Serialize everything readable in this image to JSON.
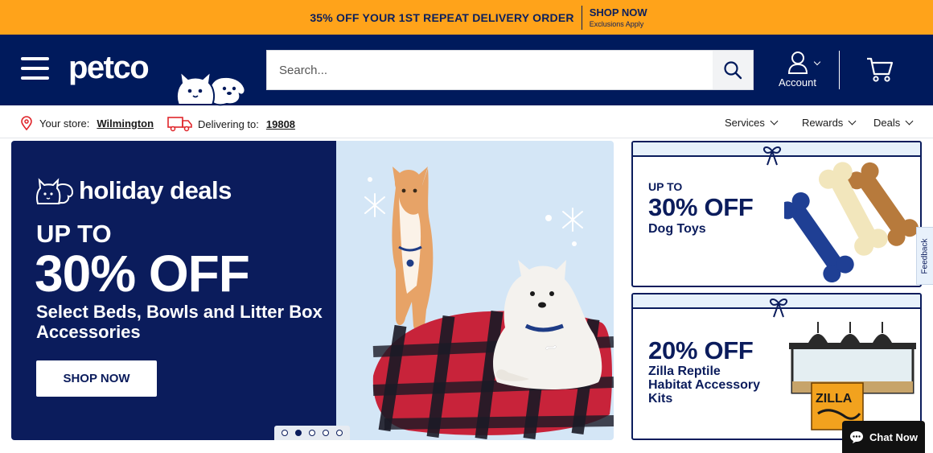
{
  "promo": {
    "main_text": "35% OFF YOUR 1ST REPEAT DELIVERY ORDER",
    "cta": "SHOP NOW",
    "cta_sub": "Exclusions Apply"
  },
  "header": {
    "logo": "petco",
    "search_placeholder": "Search...",
    "account_label": "Account"
  },
  "subnav": {
    "store_label": "Your store:",
    "store_name": "Wilmington",
    "deliver_label": "Delivering to:",
    "zip": "19808",
    "links": [
      "Services",
      "Rewards",
      "Deals"
    ]
  },
  "hero": {
    "brand": "holiday deals",
    "upto": "UP TO",
    "percent": "30% OFF",
    "subtitle": "Select Beds, Bowls and Litter Box Accessories",
    "cta": "SHOP NOW",
    "slides_count": 5,
    "active_slide": 2
  },
  "cards": [
    {
      "line1": "UP TO",
      "line2": "30% OFF",
      "line3": "Dog Toys"
    },
    {
      "line1": "",
      "line2": "20% OFF",
      "line3": "Zilla Reptile Habitat Accessory Kits",
      "product_brand": "ZILLA"
    }
  ],
  "feedback": "Feedback",
  "chat": "Chat Now",
  "colors": {
    "navy": "#001a5c",
    "promo": "#ffa31a",
    "sky": "#d4e6f6"
  }
}
